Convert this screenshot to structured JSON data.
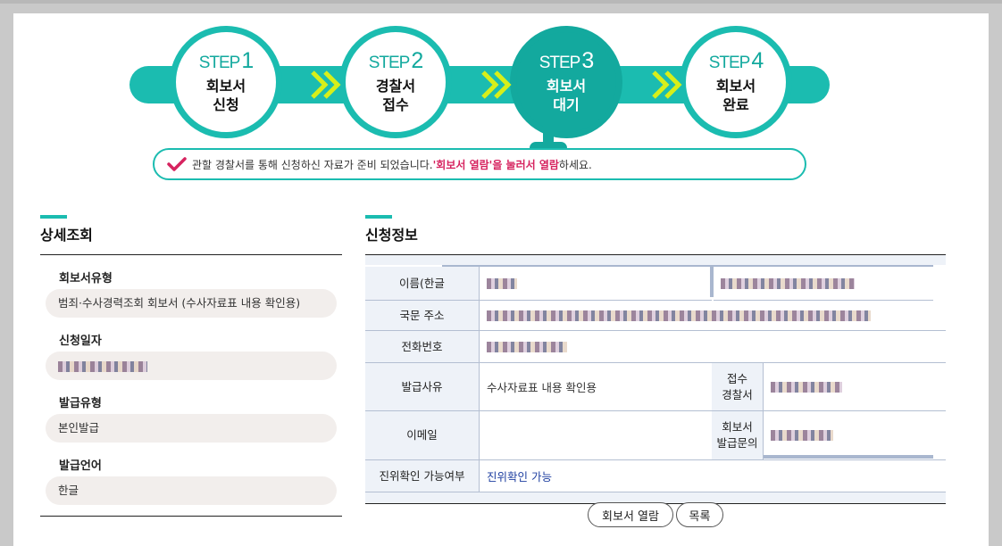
{
  "steps": [
    {
      "label": "STEP",
      "num": "1",
      "title": "회보서\n신청"
    },
    {
      "label": "STEP",
      "num": "2",
      "title": "경찰서\n접수"
    },
    {
      "label": "STEP",
      "num": "3",
      "title": "회보서\n대기"
    },
    {
      "label": "STEP",
      "num": "4",
      "title": "회보서\n완료"
    }
  ],
  "active_step": 3,
  "notice": {
    "text1": "관할 경찰서를 통해 신청하신 자료가 준비 되었습니다. ",
    "highlight": "'회보서 열람'을 눌러서 열람",
    "text2": "하세요."
  },
  "detail": {
    "title": "상세조회",
    "fields": [
      {
        "label": "회보서유형",
        "value": "범죄·수사경력조회 회보서 (수사자료표 내용 확인용)"
      },
      {
        "label": "신청일자",
        "value": ""
      },
      {
        "label": "발급유형",
        "value": "본인발급"
      },
      {
        "label": "발급언어",
        "value": "한글"
      }
    ]
  },
  "application": {
    "title": "신청정보",
    "rows": {
      "name_label": "이름(한글",
      "addr_label": "국문 주소",
      "phone_label": "전화번호",
      "reason_label": "발급사유",
      "reason_value": "수사자료표 내용 확인용",
      "receipt_label": "접수\n경찰서",
      "email_label": "이메일",
      "inquiry_label": "회보서\n발급문의",
      "verify_label": "진위확인 가능여부",
      "verify_value": "진위확인 가능"
    }
  },
  "buttons": {
    "view": "회보서 열람",
    "list": "목록"
  },
  "colors": {
    "accent": "#1bbcb0",
    "accent_dark": "#13a99e",
    "highlight": "#d6235f",
    "chevron": "#d7ef1a"
  }
}
